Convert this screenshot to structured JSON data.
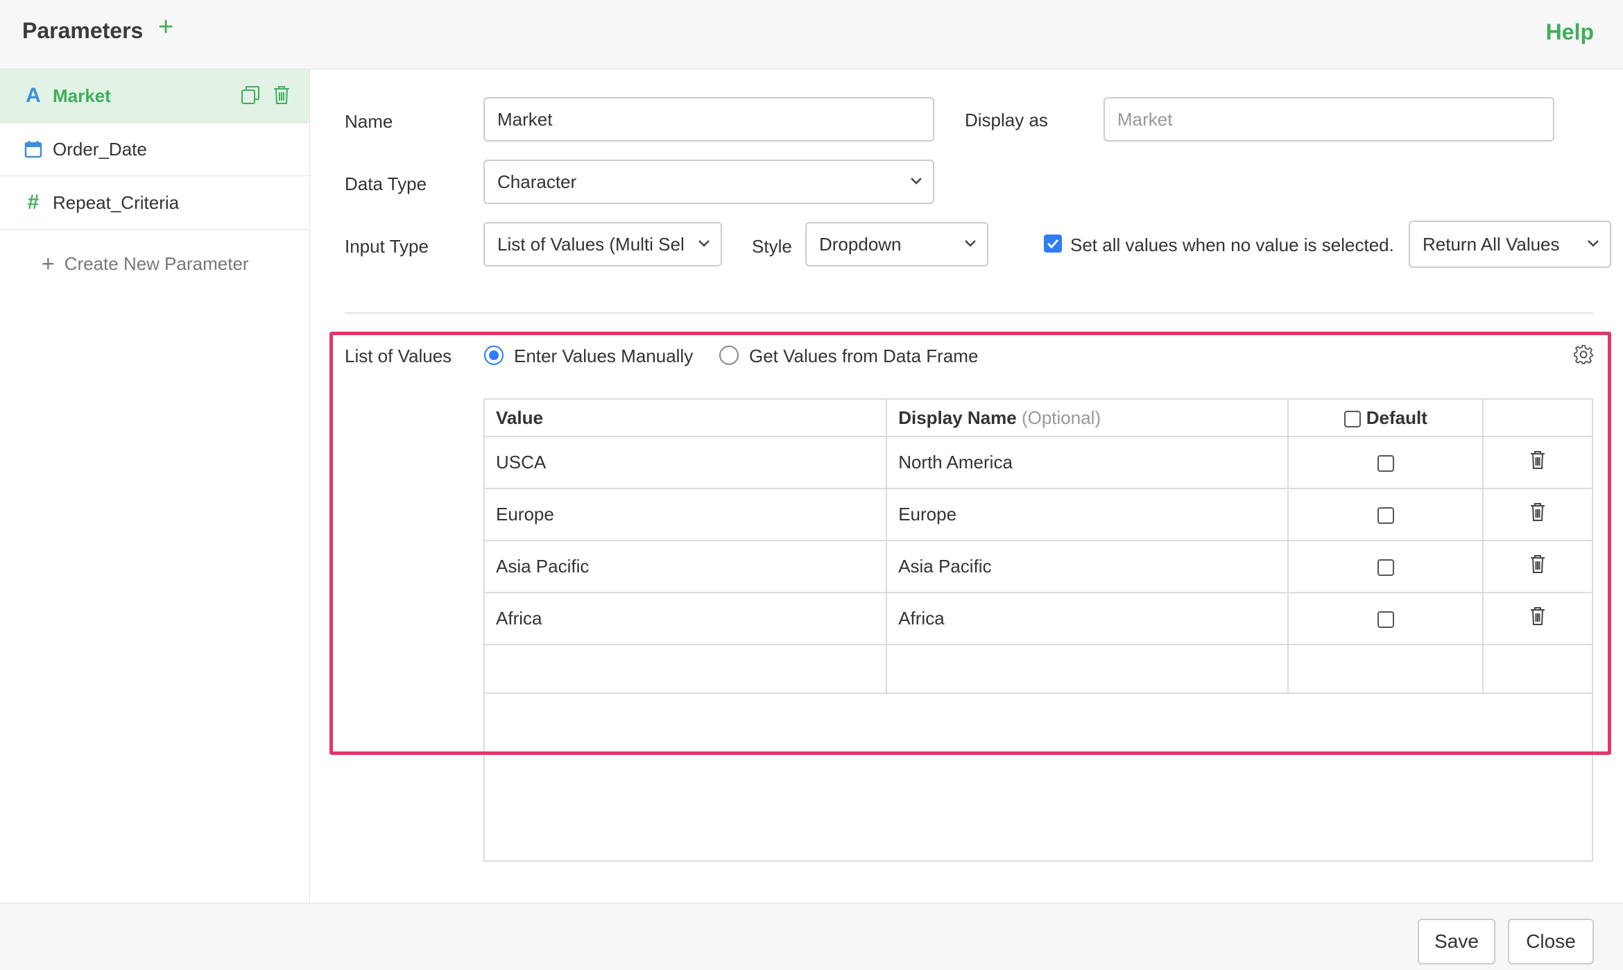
{
  "header": {
    "title": "Parameters",
    "help": "Help"
  },
  "sidebar": {
    "items": [
      {
        "label": "Market",
        "icon": "letter-a-icon",
        "active": true
      },
      {
        "label": "Order_Date",
        "icon": "calendar-icon"
      },
      {
        "label": "Repeat_Criteria",
        "icon": "hash-icon"
      }
    ],
    "create_label": "Create New Parameter"
  },
  "form": {
    "name_label": "Name",
    "name_value": "Market",
    "display_as_label": "Display as",
    "display_as_placeholder": "Market",
    "data_type_label": "Data Type",
    "data_type_value": "Character",
    "input_type_label": "Input Type",
    "input_type_value": "List of Values (Multi Sel",
    "style_label": "Style",
    "style_value": "Dropdown",
    "set_all_label": "Set all values when no value is selected.",
    "set_all_checked": true,
    "return_value": "Return All Values"
  },
  "list_of_values": {
    "label": "List of Values",
    "option_manual": "Enter Values Manually",
    "option_data_frame": "Get Values from Data Frame",
    "selected": "manual",
    "columns": {
      "value": "Value",
      "display_name": "Display Name",
      "optional": "(Optional)",
      "default": "Default"
    },
    "rows": [
      {
        "value": "USCA",
        "display": "North America"
      },
      {
        "value": "Europe",
        "display": "Europe"
      },
      {
        "value": "Asia Pacific",
        "display": "Asia Pacific"
      },
      {
        "value": "Africa",
        "display": "Africa"
      }
    ]
  },
  "footer": {
    "save": "Save",
    "close": "Close"
  },
  "colors": {
    "accent_green": "#3fae5b",
    "highlight": "#e0386a",
    "blue": "#2f7cf6"
  }
}
